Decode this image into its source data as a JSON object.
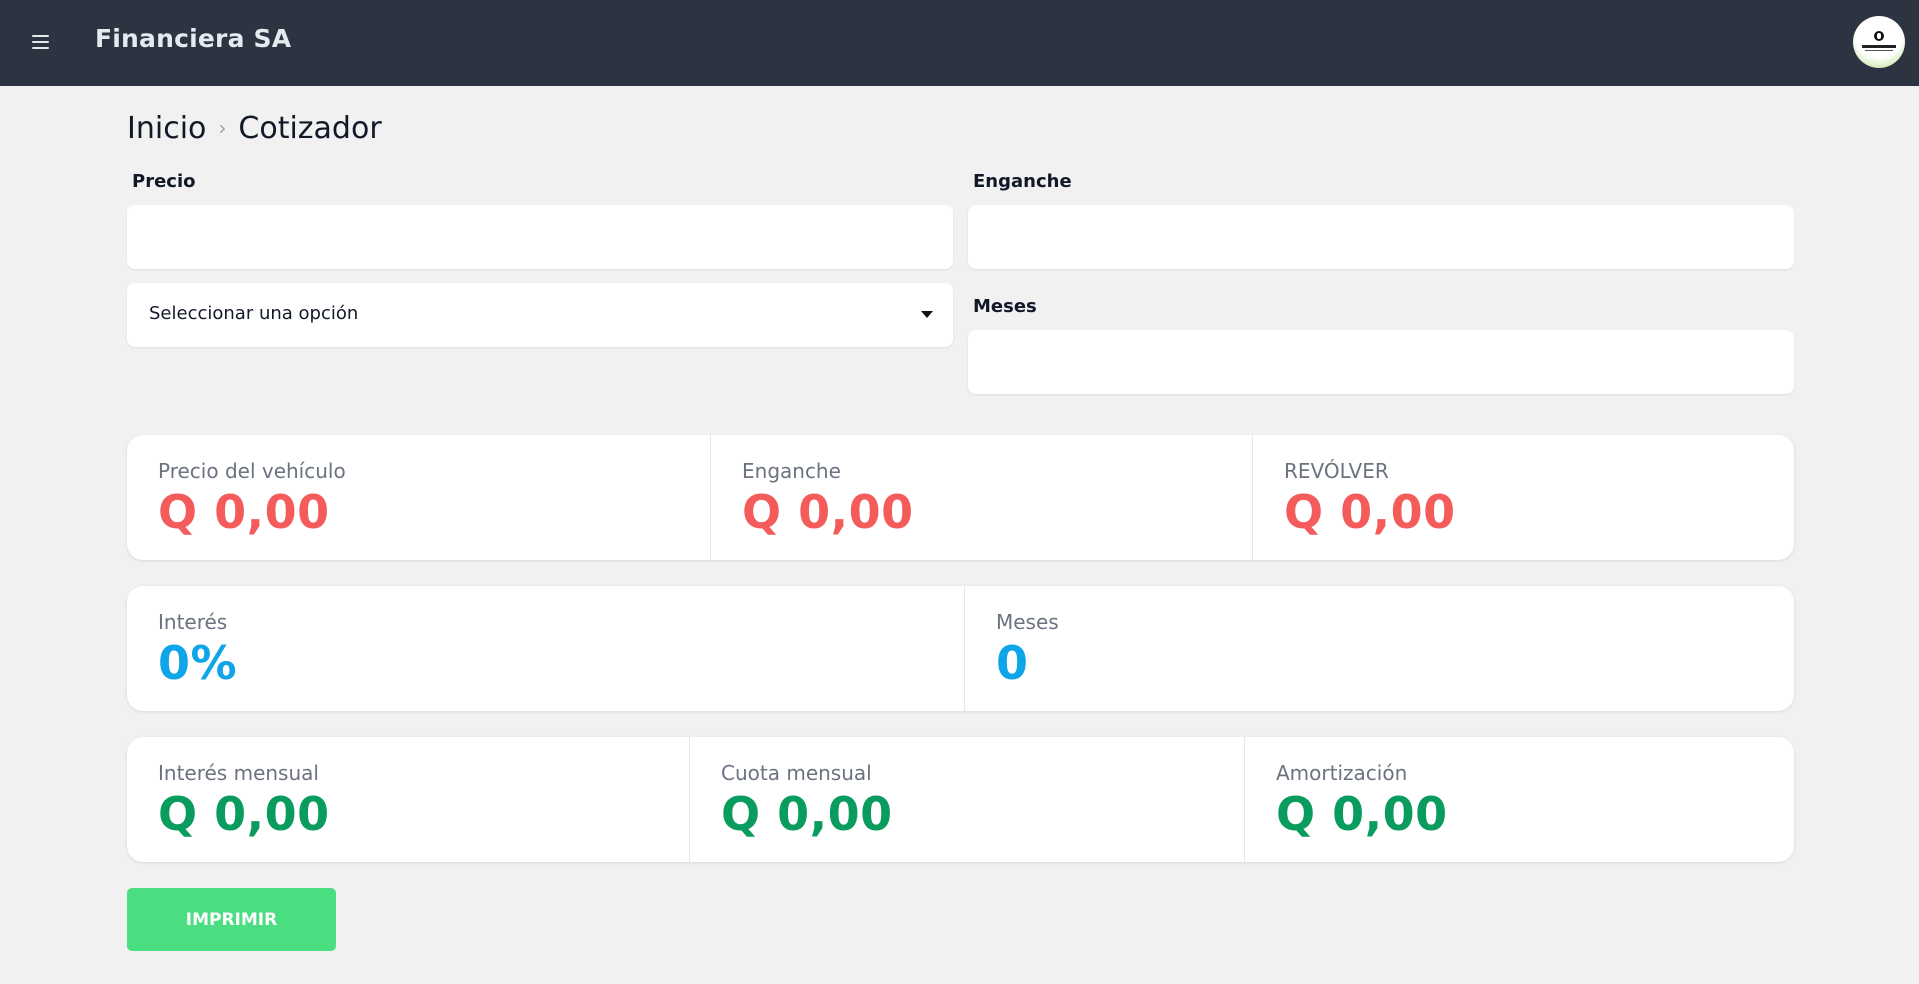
{
  "header": {
    "brand": "Financiera SA",
    "menu_icon": "hamburger-menu-icon",
    "avatar_icon": "company-logo-avatar"
  },
  "breadcrumb": {
    "items": [
      "Inicio",
      "Cotizador"
    ],
    "separator": "›"
  },
  "form": {
    "precio_label": "Precio",
    "precio_value": "",
    "enganche_label": "Enganche",
    "enganche_value": "",
    "tipo_select": "Seleccionar una opción",
    "meses_label": "Meses",
    "meses_value": ""
  },
  "summary": {
    "row1": [
      {
        "label": "Precio del vehículo",
        "value": "Q 0,00"
      },
      {
        "label": "Enganche",
        "value": "Q 0,00"
      },
      {
        "label": "REVÓLVER",
        "value": "Q 0,00"
      }
    ],
    "row2": [
      {
        "label": "Interés",
        "value": "0%"
      },
      {
        "label": "Meses",
        "value": "0"
      }
    ],
    "row3": [
      {
        "label": "Interés mensual",
        "value": "Q 0,00"
      },
      {
        "label": "Cuota mensual",
        "value": "Q 0,00"
      },
      {
        "label": "Amortización",
        "value": "Q 0,00"
      }
    ]
  },
  "actions": {
    "print_label": "IMPRIMIR"
  },
  "colors": {
    "topbar": "#2c3442",
    "red_value": "#f45b5b",
    "blue_value": "#0ea5e9",
    "green_value": "#0a9c5e",
    "print_button": "#4ade80"
  }
}
